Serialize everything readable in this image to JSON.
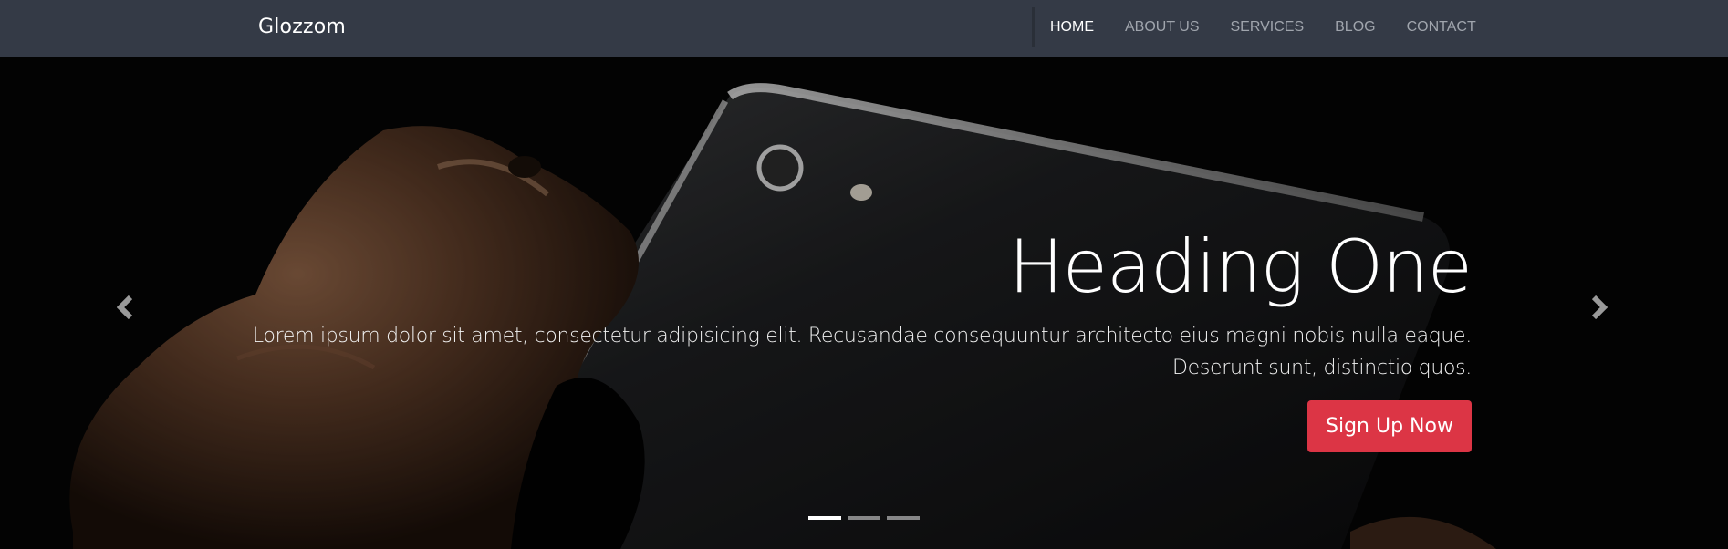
{
  "navbar": {
    "brand": "Glozzom",
    "items": [
      {
        "label": "HOME",
        "active": true
      },
      {
        "label": "ABOUT US",
        "active": false
      },
      {
        "label": "SERVICES",
        "active": false
      },
      {
        "label": "BLOG",
        "active": false
      },
      {
        "label": "CONTACT",
        "active": false
      }
    ]
  },
  "carousel": {
    "heading": "Heading One",
    "text_line1": "Lorem ipsum dolor sit amet, consectetur adipisicing elit. Recusandae consequuntur architecto eius magni nobis nulla eaque.",
    "text_line2": "Deserunt sunt, distinctio quos.",
    "cta_label": "Sign Up Now",
    "prev_icon": "chevron-left-icon",
    "next_icon": "chevron-right-icon",
    "active_slide": 1,
    "slide_count": 3
  },
  "colors": {
    "navbar_bg": "#343a46",
    "cta": "#dc3545",
    "nav_inactive": "#a0a5ad"
  }
}
